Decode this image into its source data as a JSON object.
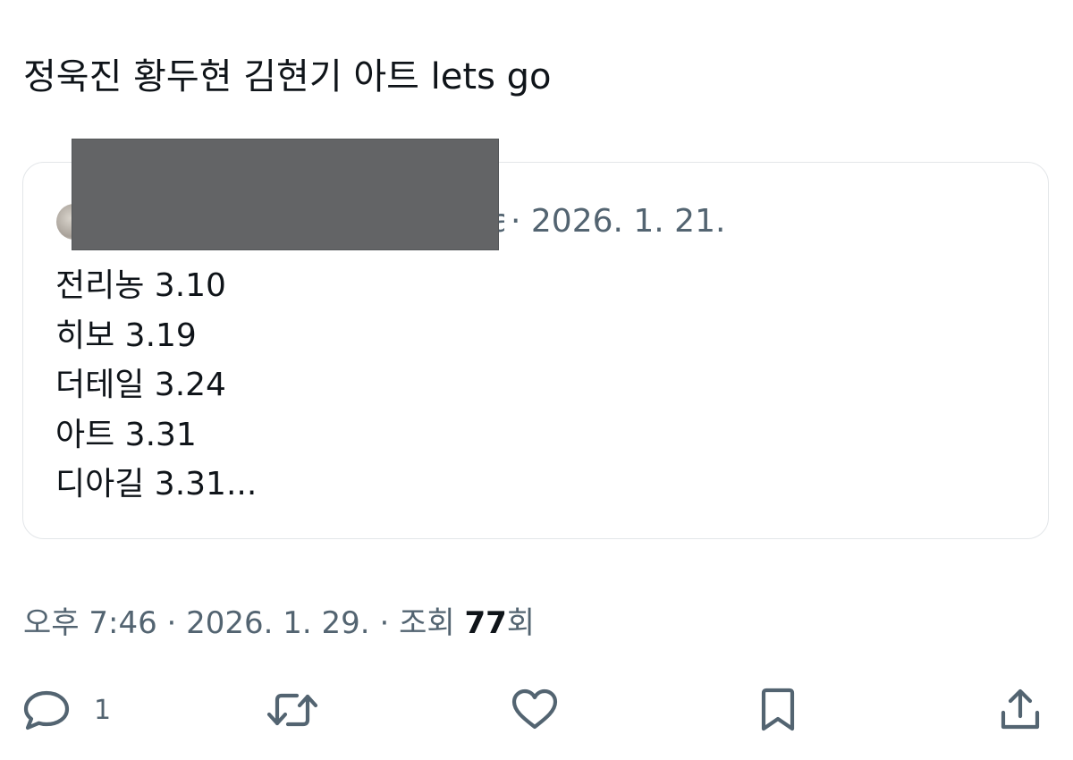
{
  "tweet": {
    "text": "정욱진 황두현 김현기 아트 lets go"
  },
  "quote": {
    "author_visible_tail": "a",
    "meta": "· 2026. 1. 21.",
    "lines": [
      "전리농 3.10",
      "히보 3.19",
      "더테일 3.24",
      "아트 3.31",
      "디아길 3.31..."
    ]
  },
  "post_meta": {
    "time": "오후 7:46",
    "separator": "·",
    "date": "2026. 1. 29.",
    "views_label": "조회",
    "views_count": "77",
    "views_suffix": "회"
  },
  "actions": {
    "reply_count": "1",
    "icons": {
      "reply": "reply-icon",
      "repost": "repost-icon",
      "like": "heart-icon",
      "bookmark": "bookmark-icon",
      "share": "share-icon"
    }
  }
}
